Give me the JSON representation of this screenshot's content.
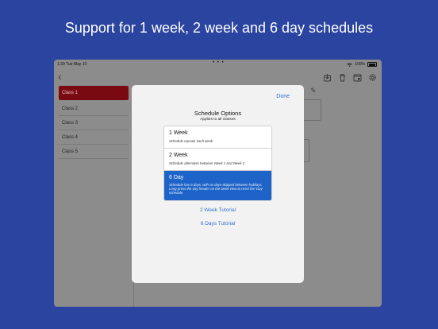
{
  "headline": "Support for 1 week, 2 week and 6 day schedules",
  "status": {
    "time": "1:39",
    "date": "Tue May 10",
    "battery": "100%"
  },
  "sidebar": {
    "items": [
      {
        "label": "Class 1"
      },
      {
        "label": "Class 2"
      },
      {
        "label": "Class 3"
      },
      {
        "label": "Class 4"
      },
      {
        "label": "Class 5"
      }
    ],
    "selected": "Class 1"
  },
  "modal": {
    "done": "Done",
    "title": "Schedule Options",
    "subtitle": "Applies to all classes",
    "options": [
      {
        "name": "1 Week",
        "desc": "Schedule repeats each week"
      },
      {
        "name": "2 Week",
        "desc": "Schedule alternates between Week 1 and Week 2"
      },
      {
        "name": "6 Day",
        "desc": "Schedule has 6 days, with no days skipped between holidays. Long press the day header on the week view to reset the 'Day' schedule."
      }
    ],
    "selected_option": "6 Day",
    "links": [
      "2 Week Tutorial",
      "6 Days Tutorial"
    ]
  },
  "colors": {
    "background": "#2a44a0",
    "selected_class": "#7a0a12",
    "selected_option": "#1e64c8",
    "link": "#2f6fd1"
  },
  "icons": [
    "back-chevron-icon",
    "download-icon",
    "trash-icon",
    "calendar-icon",
    "gear-icon",
    "pencil-icon",
    "wifi-icon",
    "battery-icon"
  ]
}
